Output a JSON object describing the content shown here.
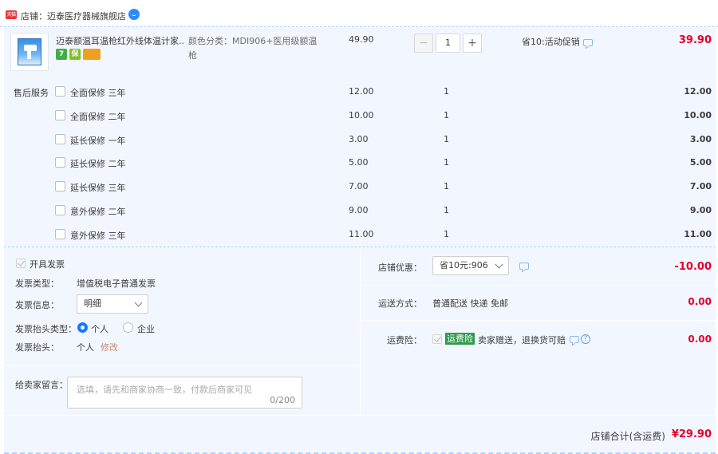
{
  "shop": {
    "badge": "天猫",
    "label": "店铺：迈泰医疗器械旗舰店"
  },
  "item": {
    "title": "迈泰额温耳温枪红外线体温计家...",
    "sku": "颜色分类：MDI906+医用级额温枪",
    "unit_price": "49.90",
    "quantity": "1",
    "promo": "省10:活动促销",
    "total": "39.90",
    "service_icons": [
      {
        "text": "7",
        "color": "#3fae49"
      },
      {
        "text": "保",
        "color": "#7fbf2f"
      },
      {
        "text": "",
        "color": "#f0a020"
      }
    ]
  },
  "services": {
    "title": "售后服务",
    "rows": [
      {
        "name": "全面保修 三年",
        "price": "12.00",
        "qty": "1",
        "total": "12.00"
      },
      {
        "name": "全面保修 二年",
        "price": "10.00",
        "qty": "1",
        "total": "10.00"
      },
      {
        "name": "延长保修 一年",
        "price": "3.00",
        "qty": "1",
        "total": "3.00"
      },
      {
        "name": "延长保修 二年",
        "price": "5.00",
        "qty": "1",
        "total": "5.00"
      },
      {
        "name": "延长保修 三年",
        "price": "7.00",
        "qty": "1",
        "total": "7.00"
      },
      {
        "name": "意外保修 二年",
        "price": "9.00",
        "qty": "1",
        "total": "9.00"
      },
      {
        "name": "意外保修 三年",
        "price": "11.00",
        "qty": "1",
        "total": "11.00"
      }
    ]
  },
  "invoice": {
    "issue_label": "开具发票",
    "type_label": "发票类型：",
    "type_value": "增值税电子普通发票",
    "info_label": "发票信息：",
    "info_value": "明细",
    "header_type_label": "发票抬头类型：",
    "option_personal": "个人",
    "option_company": "企业",
    "header_label": "发票抬头：",
    "header_value": "个人",
    "modify": "修改"
  },
  "message": {
    "label": "给卖家留言：",
    "placeholder": "选填，请先和商家协商一致，付款后商家可见",
    "count": "0/200"
  },
  "discount": {
    "label": "店铺优惠：",
    "selected": "省10元:906",
    "amount": "-10.00"
  },
  "shipping": {
    "label": "运送方式：",
    "value": "普通配送 快递 免邮",
    "amount": "0.00"
  },
  "insurance": {
    "label": "运费险：",
    "badge": "运费险",
    "desc": "卖家赠送，退换货可赔",
    "help": "?",
    "amount": "0.00"
  },
  "footer": {
    "label": "店铺合计(含运费)",
    "amount": "¥29.90"
  },
  "colors": {
    "accent_red": "#e4002b",
    "panel_bg": "#f2f7ff",
    "primary_blue": "#1677ff"
  }
}
